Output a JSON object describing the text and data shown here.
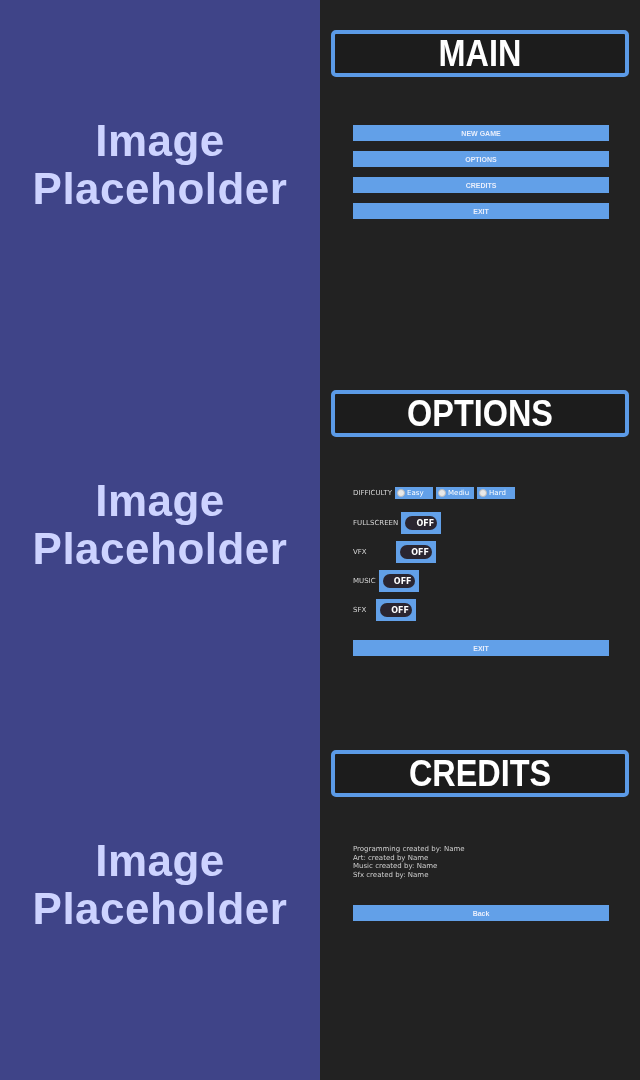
{
  "screens": [
    {
      "kind": "main",
      "image_text": [
        "Image",
        "Placeholder"
      ],
      "title": "MAIN",
      "buttons": [
        "NEW GAME",
        "OPTIONS",
        "CREDITS",
        "EXIT"
      ]
    },
    {
      "kind": "options",
      "image_text": [
        "Image",
        "Placeholder"
      ],
      "title": "OPTIONS",
      "difficulty": {
        "label": "DIFFICULTY",
        "options": [
          {
            "label": "Easy",
            "selected": false
          },
          {
            "label": "Mediu",
            "selected": false
          },
          {
            "label": "Hard",
            "selected": false
          }
        ]
      },
      "toggles": [
        {
          "label": "FULLSCREEN",
          "on": false,
          "state_text": "OFF"
        },
        {
          "label": "VFX",
          "on": false,
          "state_text": "OFF"
        },
        {
          "label": "MUSIC",
          "on": false,
          "state_text": "OFF"
        },
        {
          "label": "SFX",
          "on": false,
          "state_text": "OFF"
        }
      ],
      "buttons": [
        "EXIT"
      ]
    },
    {
      "kind": "credits",
      "image_text": [
        "Image",
        "Placeholder"
      ],
      "title": "CREDITS",
      "lines": [
        "Programming created by: Name",
        "Art: created by Name",
        "Music created by: Name",
        "Sfx created by: Name"
      ],
      "buttons": [
        "Back"
      ]
    }
  ]
}
